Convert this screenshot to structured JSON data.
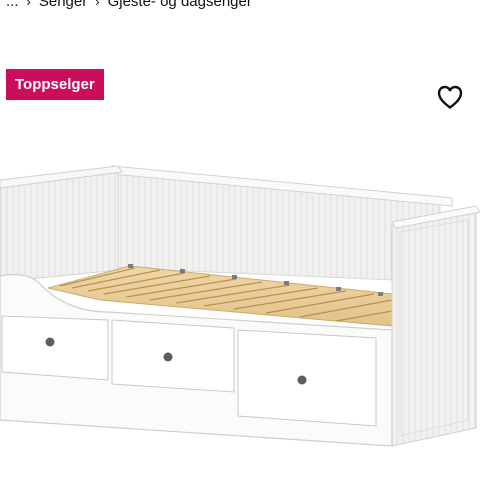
{
  "breadcrumb": {
    "items": [
      "...",
      "Senger",
      "Gjeste- og dagsenger"
    ],
    "separator": "›"
  },
  "badge": {
    "label": "Toppselger",
    "color": "#cc0e5a"
  },
  "favorite": {
    "icon": "heart-outline-icon"
  },
  "product_image": {
    "subject": "white daybed with three drawers and pine slats"
  }
}
